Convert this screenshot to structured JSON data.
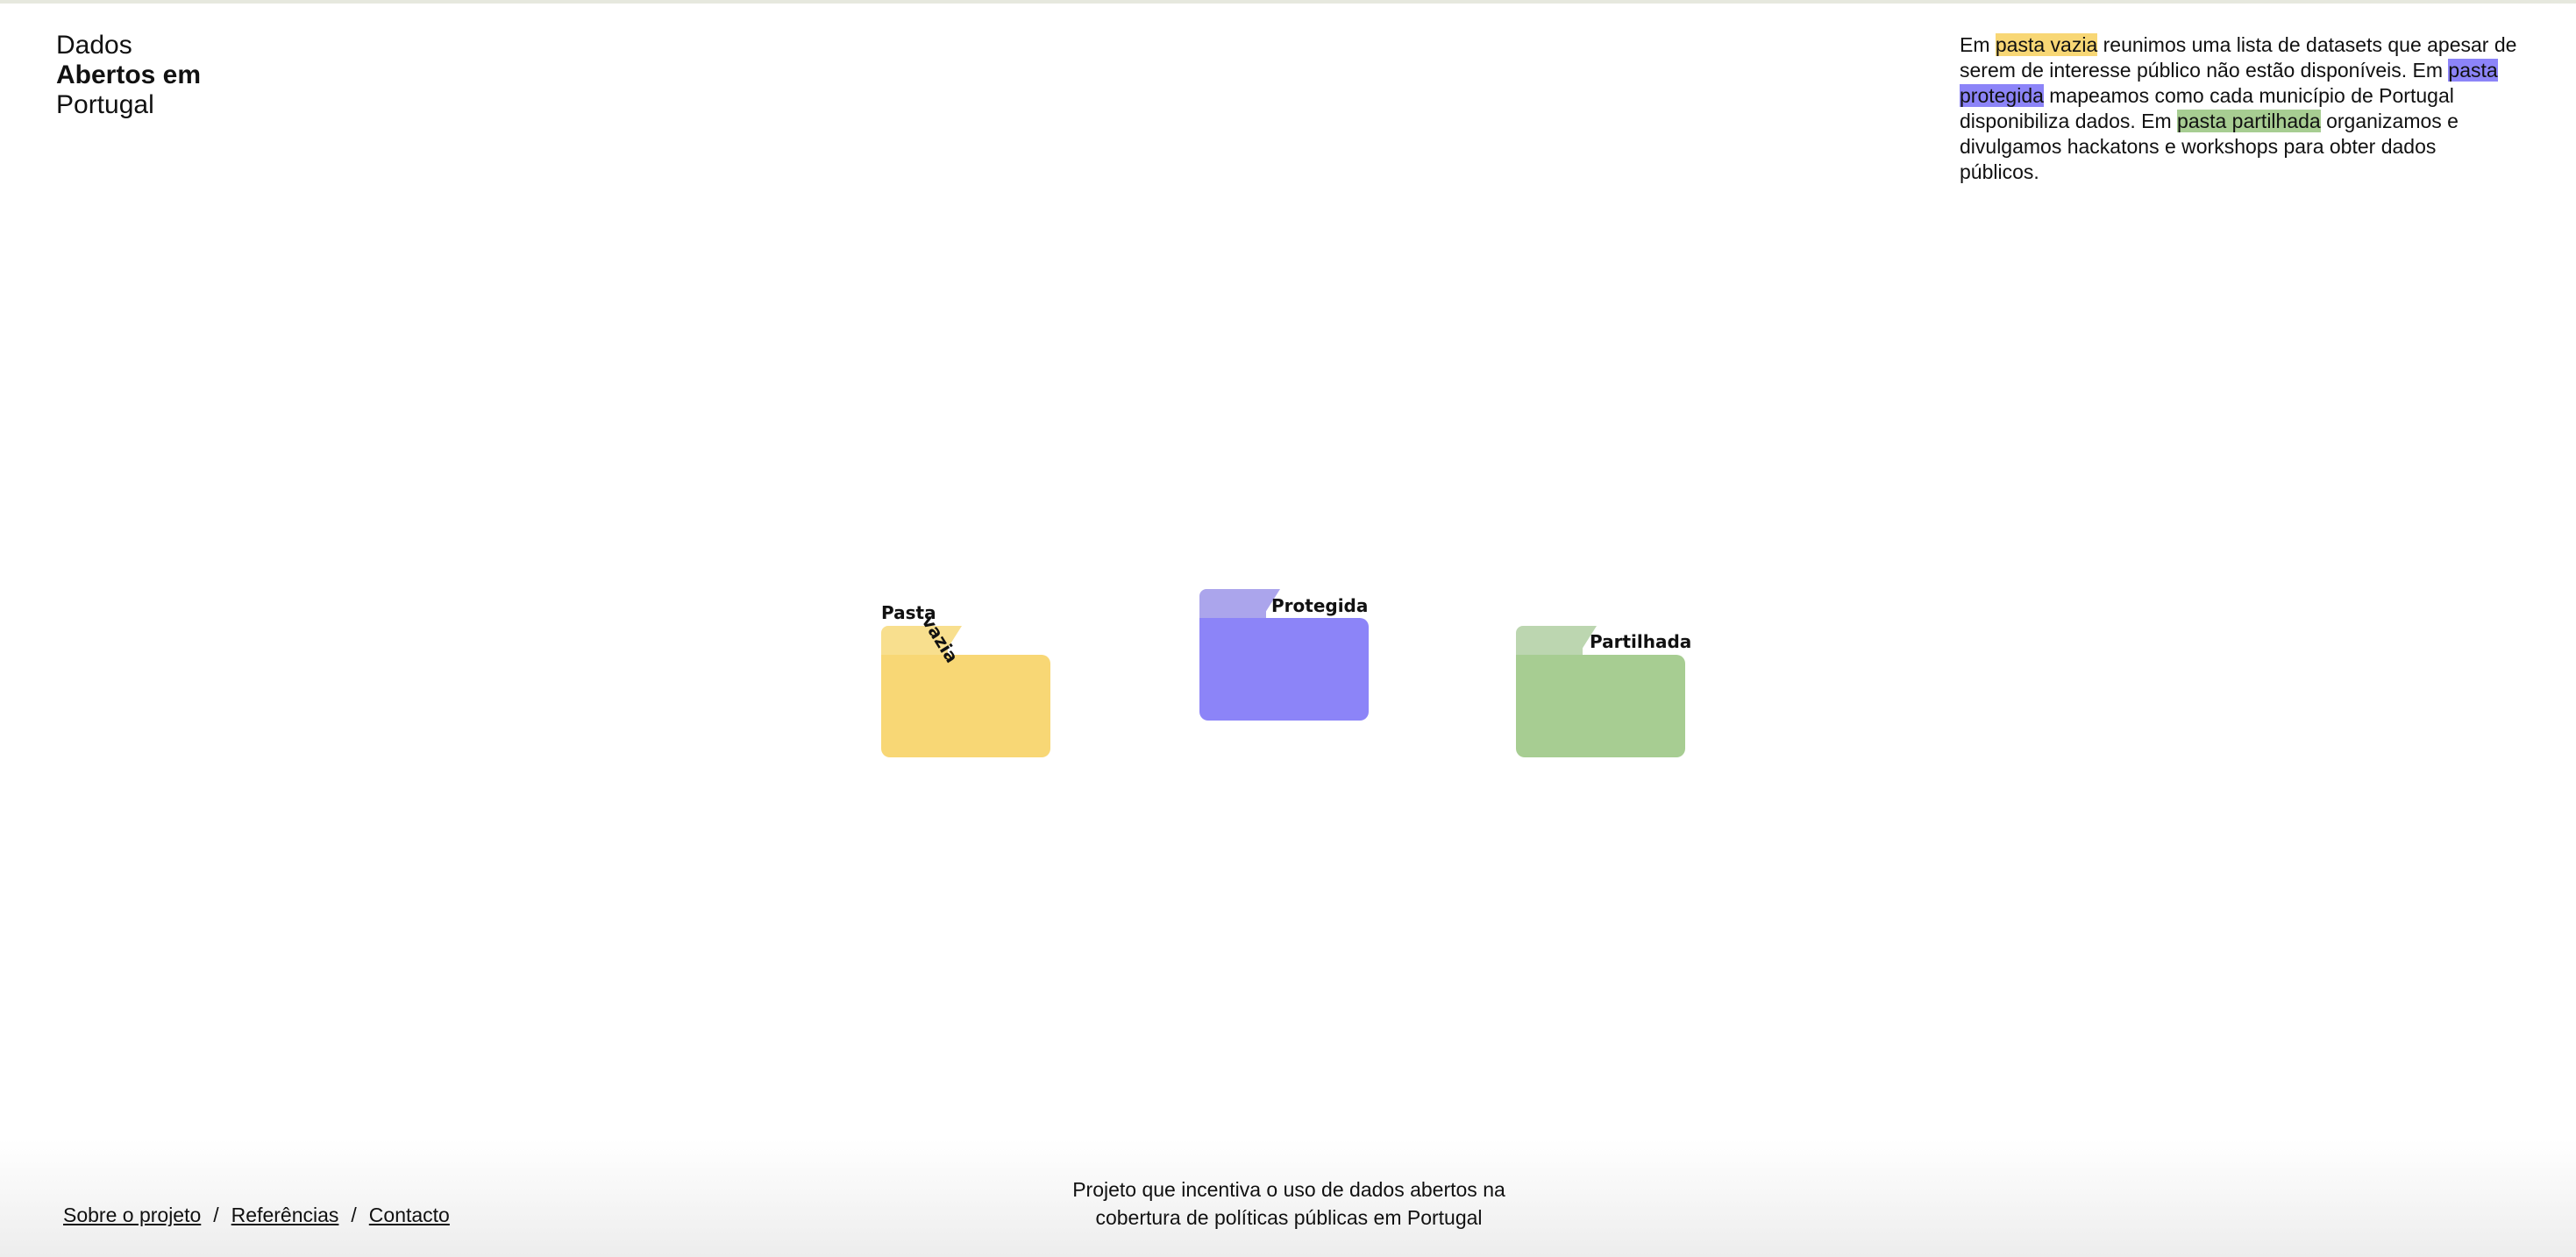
{
  "brand": {
    "line1": "Dados",
    "line2": "Abertos em",
    "line3": "Portugal"
  },
  "intro": {
    "p1": "Em ",
    "hl_vazia": "pasta vazia",
    "p2": " reunimos uma lista de datasets que apesar de serem de interesse público não estão disponíveis. Em ",
    "hl_protegida": "pasta protegida",
    "p3": " mapeamos como cada município de Portugal disponibiliza dados. Em ",
    "hl_partilhada": "pasta partilhada",
    "p4": " organizamos e divulgamos hackatons e workshops para obter dados públicos."
  },
  "folders": {
    "vazia": {
      "label_part1": "Pasta",
      "label_part2": "vazia",
      "color": "#f8d775"
    },
    "protegida": {
      "label": "Protegida",
      "color": "#8c84f8"
    },
    "partilhada": {
      "label": "Partilhada",
      "color": "#a7cd92"
    }
  },
  "footer": {
    "nav": [
      {
        "label": "Sobre o projeto"
      },
      {
        "label": "Referências"
      },
      {
        "label": "Contacto"
      }
    ],
    "separator": "/",
    "tagline_line1": "Projeto que incentiva o uso de dados abertos na",
    "tagline_line2": "cobertura de políticas públicas em Portugal"
  }
}
